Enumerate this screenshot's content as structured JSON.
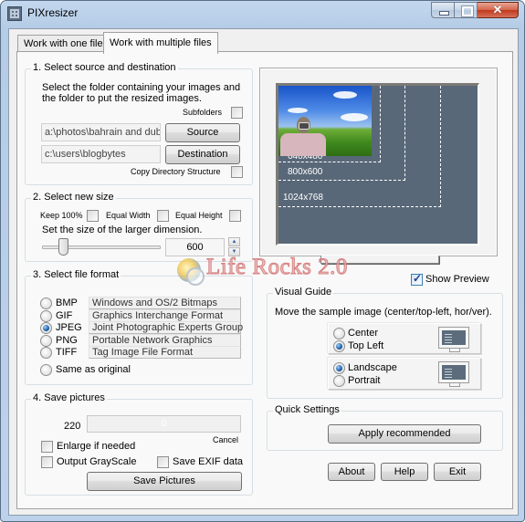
{
  "window": {
    "title": "PIXresizer",
    "controls": {
      "minimize": "minimize",
      "maximize": "maximize",
      "close": "✕"
    }
  },
  "tabs": [
    {
      "label": "Work with one file",
      "active": false
    },
    {
      "label": "Work with multiple files",
      "active": true
    }
  ],
  "source_dest": {
    "legend": "1. Select source and destination",
    "description_line1": "Select the folder containing your images and",
    "description_line2": "the folder to put the resized images.",
    "subfolders_label": "Subfolders",
    "subfolders_checked": false,
    "source_path": "a:\\photos\\bahrain and dub",
    "source_button": "Source",
    "destination_path": "c:\\users\\blogbytes",
    "destination_button": "Destination",
    "copy_structure_label": "Copy Directory Structure",
    "copy_structure_checked": false
  },
  "new_size": {
    "legend": "2. Select new size",
    "keep_100_label": "Keep 100%",
    "keep_100_checked": false,
    "equal_width_label": "Equal Width",
    "equal_width_checked": false,
    "equal_height_label": "Equal Height",
    "equal_height_checked": false,
    "instruction": "Set the size of the larger dimension.",
    "size_value": "600",
    "slider_fraction": 0.18,
    "spin_up": "▲",
    "spin_down": "▼"
  },
  "file_format": {
    "legend": "3. Select file format",
    "options": [
      {
        "name": "BMP",
        "description": "Windows and OS/2 Bitmaps",
        "checked": false
      },
      {
        "name": "GIF",
        "description": "Graphics Interchange Format",
        "checked": false
      },
      {
        "name": "JPEG",
        "description": "Joint Photographic Experts Group",
        "checked": true
      },
      {
        "name": "PNG",
        "description": "Portable Network Graphics",
        "checked": false
      },
      {
        "name": "TIFF",
        "description": "Tag Image File Format",
        "checked": false
      }
    ],
    "same_as_original_label": "Same as original",
    "same_as_original_checked": false
  },
  "save": {
    "legend": "4. Save pictures",
    "file_count": "220",
    "progress_value": "0",
    "progress_fraction": 0,
    "cancel_label": "Cancel",
    "enlarge_label": "Enlarge if needed",
    "enlarge_checked": false,
    "grayscale_label": "Output GrayScale",
    "grayscale_checked": false,
    "exif_label": "Save EXIF data",
    "exif_checked": false,
    "save_button": "Save Pictures"
  },
  "preview": {
    "guides": [
      "640x480",
      "800x600",
      "1024x768"
    ],
    "show_preview_label": "Show Preview",
    "show_preview_checked": true
  },
  "visual_guide": {
    "legend": "Visual Guide",
    "description": "Move the sample image (center/top-left, hor/ver).",
    "position_options": [
      {
        "label": "Center",
        "checked": false
      },
      {
        "label": "Top Left",
        "checked": true
      }
    ],
    "orientation_options": [
      {
        "label": "Landscape",
        "checked": true
      },
      {
        "label": "Portrait",
        "checked": false
      }
    ]
  },
  "quick_settings": {
    "legend": "Quick Settings",
    "apply_button": "Apply recommended"
  },
  "footer_buttons": {
    "about": "About",
    "help": "Help",
    "exit": "Exit"
  },
  "watermark": {
    "text": "Life Rocks 2.0"
  }
}
